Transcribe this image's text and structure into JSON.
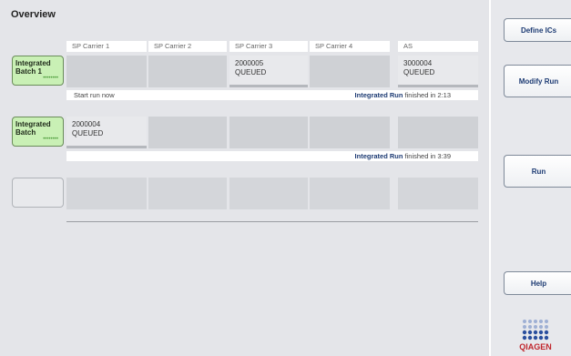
{
  "overview": {
    "title": "Overview"
  },
  "columns": [
    "SP Carrier 1",
    "SP Carrier 2",
    "SP Carrier 3",
    "SP Carrier 4",
    "AS"
  ],
  "batches": [
    {
      "label": "Integrated\nBatch 1",
      "dots": "••••••••",
      "cells": [
        {
          "id": "",
          "status": ""
        },
        {
          "id": "",
          "status": ""
        },
        {
          "id": "2000005",
          "status": "QUEUED"
        },
        {
          "id": "",
          "status": ""
        },
        {
          "id": "3000004",
          "status": "QUEUED"
        }
      ],
      "status_left": "Start run now",
      "run_label": "Integrated Run",
      "finished_text": "finished in 2:13"
    },
    {
      "label": "Integrated\nBatch",
      "dots": "••••••••",
      "cells": [
        {
          "id": "2000004",
          "status": "QUEUED"
        },
        {
          "id": "",
          "status": ""
        },
        {
          "id": "",
          "status": ""
        },
        {
          "id": "",
          "status": ""
        },
        {
          "id": "",
          "status": ""
        }
      ],
      "status_left": "",
      "run_label": "Integrated Run",
      "finished_text": "finished in 3:39"
    }
  ],
  "sidebar": {
    "define_ics": "Define ICs",
    "modify_run": "Modify Run",
    "run": "Run",
    "help": "Help",
    "logo_text": "QIAGEN"
  },
  "colors": {
    "batch_green": "#c9f0b5",
    "accent_blue": "#1d3b73",
    "logo_blue": "#2a4f9e",
    "logo_red": "#c0262d"
  }
}
